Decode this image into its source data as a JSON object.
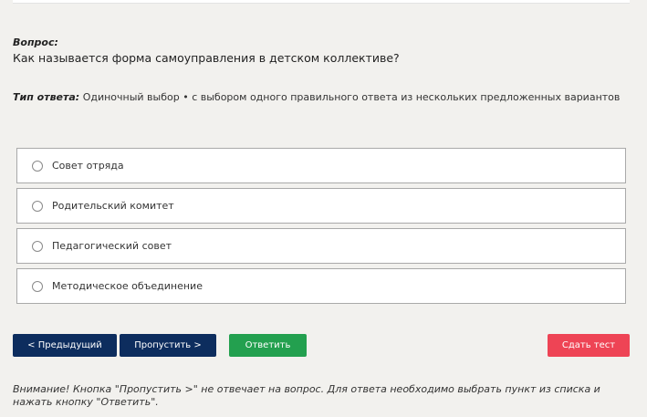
{
  "question": {
    "label": "Вопрос:",
    "text": "Как называется форма самоуправления в детском коллективе?"
  },
  "answer_type": {
    "label": "Тип ответа:",
    "value": "Одиночный выбор • с выбором одного правильного ответа из нескольких предложенных вариантов"
  },
  "options": [
    {
      "label": "Совет отряда"
    },
    {
      "label": "Родительский комитет"
    },
    {
      "label": "Педагогический совет"
    },
    {
      "label": "Методическое объединение"
    }
  ],
  "buttons": {
    "prev": "< Предыдущий",
    "skip": "Пропустить >",
    "answer": "Ответить",
    "submit": "Сдать тест"
  },
  "colors": {
    "nav_button": "#0d2d5e",
    "answer_button": "#23a04f",
    "submit_button": "#ee4455",
    "background": "#f2f1ee"
  },
  "note": "Внимание! Кнопка \"Пропустить >\" не отвечает на вопрос. Для ответа необходимо выбрать пункт из списка и нажать кнопку \"Ответить\"."
}
